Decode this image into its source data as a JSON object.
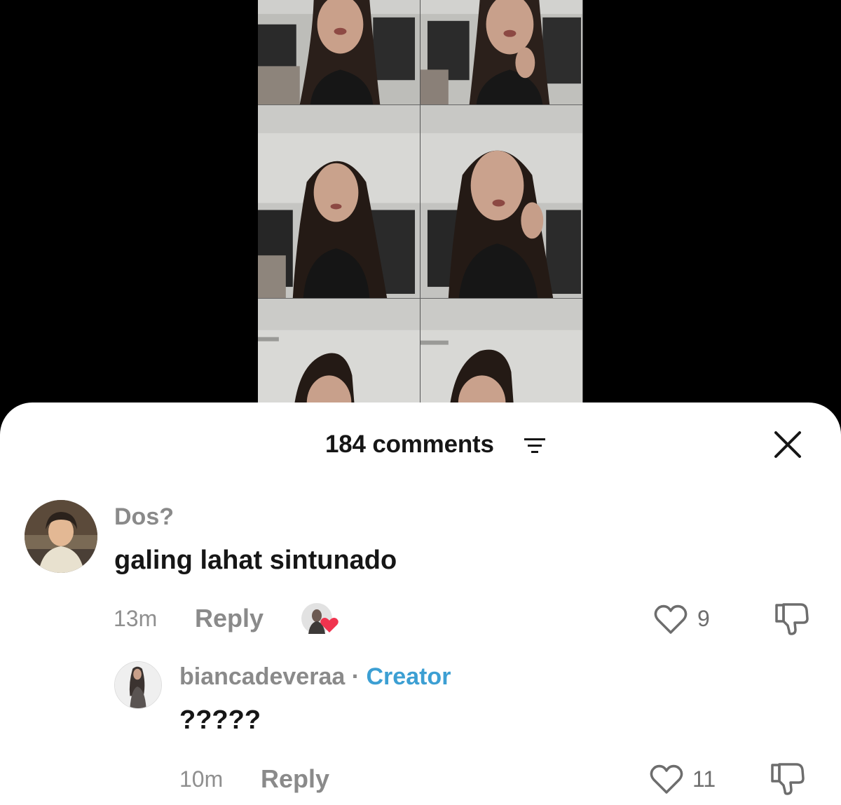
{
  "sheet": {
    "comment_count": "184 comments",
    "sort_icon": "sort-lines-icon",
    "close_icon": "close-x-icon"
  },
  "comments": [
    {
      "username": "Dos?",
      "text": "galing lahat sintunado",
      "time": "13m",
      "reply_label": "Reply",
      "liked_by_creator_icon": "creator-heart-badge-icon",
      "like_count": "9",
      "like_icon": "heart-outline-icon",
      "dislike_icon": "thumbs-down-icon"
    }
  ],
  "reply": {
    "username": "biancadeveraa",
    "separator": "·",
    "badge": "Creator",
    "text": "?????",
    "time": "10m",
    "reply_label": "Reply",
    "like_count": "11",
    "like_icon": "heart-outline-icon",
    "dislike_icon": "thumbs-down-icon"
  },
  "colors": {
    "creator_badge": "#3c9fd3",
    "heart_red": "#f0334e",
    "muted_text": "#8a8a8a"
  }
}
